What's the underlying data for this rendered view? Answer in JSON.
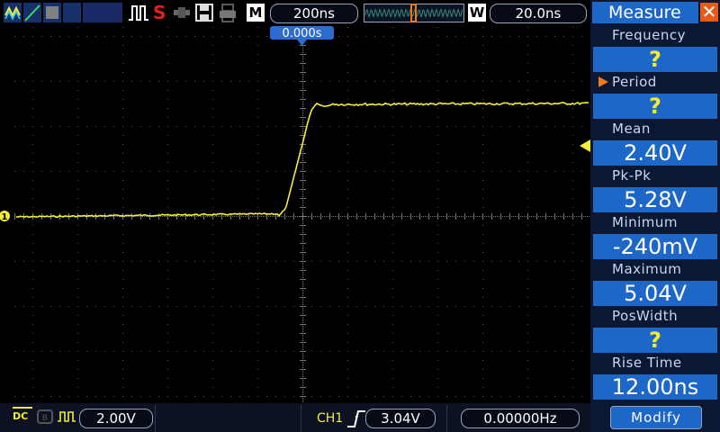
{
  "top_bar": {
    "icons": [
      "channel-waveform-icon",
      "cursor-line-icon",
      "acquire-icon",
      "trigger-pulse-icon",
      "probe-icon",
      "save-disk-icon",
      "print-icon"
    ],
    "run_status": "S",
    "menu_badge": "M",
    "timebase": "200ns",
    "window_badge": "W",
    "window_timebase": "20.0ns",
    "trigger_time": "0.000s"
  },
  "bottom_bar": {
    "coupling_label": "DC",
    "volts_per_div": "2.00V",
    "trigger_source": "CH1",
    "trigger_level": "3.04V",
    "frequency": "0.00000Hz"
  },
  "colors": {
    "trace": "#f2ee3a",
    "panel_bg": "#0c1733",
    "value_bg": "#1d67c9",
    "close_button": "#e65b17",
    "active_marker": "#f07a1a"
  },
  "channel_marker": "1",
  "measure_panel": {
    "title": "Measure",
    "close_symbol": "✕",
    "items": [
      {
        "label": "Frequency",
        "value": "?"
      },
      {
        "label": "Period",
        "value": "?",
        "selected": true
      },
      {
        "label": "Mean",
        "value": "2.40V"
      },
      {
        "label": "Pk-Pk",
        "value": "5.28V"
      },
      {
        "label": "Minimum",
        "value": "-240mV"
      },
      {
        "label": "Maximum",
        "value": "5.04V"
      },
      {
        "label": "PosWidth",
        "value": "?"
      },
      {
        "label": "Rise Time",
        "value": "12.00ns"
      }
    ],
    "modify_label": "Modify"
  }
}
